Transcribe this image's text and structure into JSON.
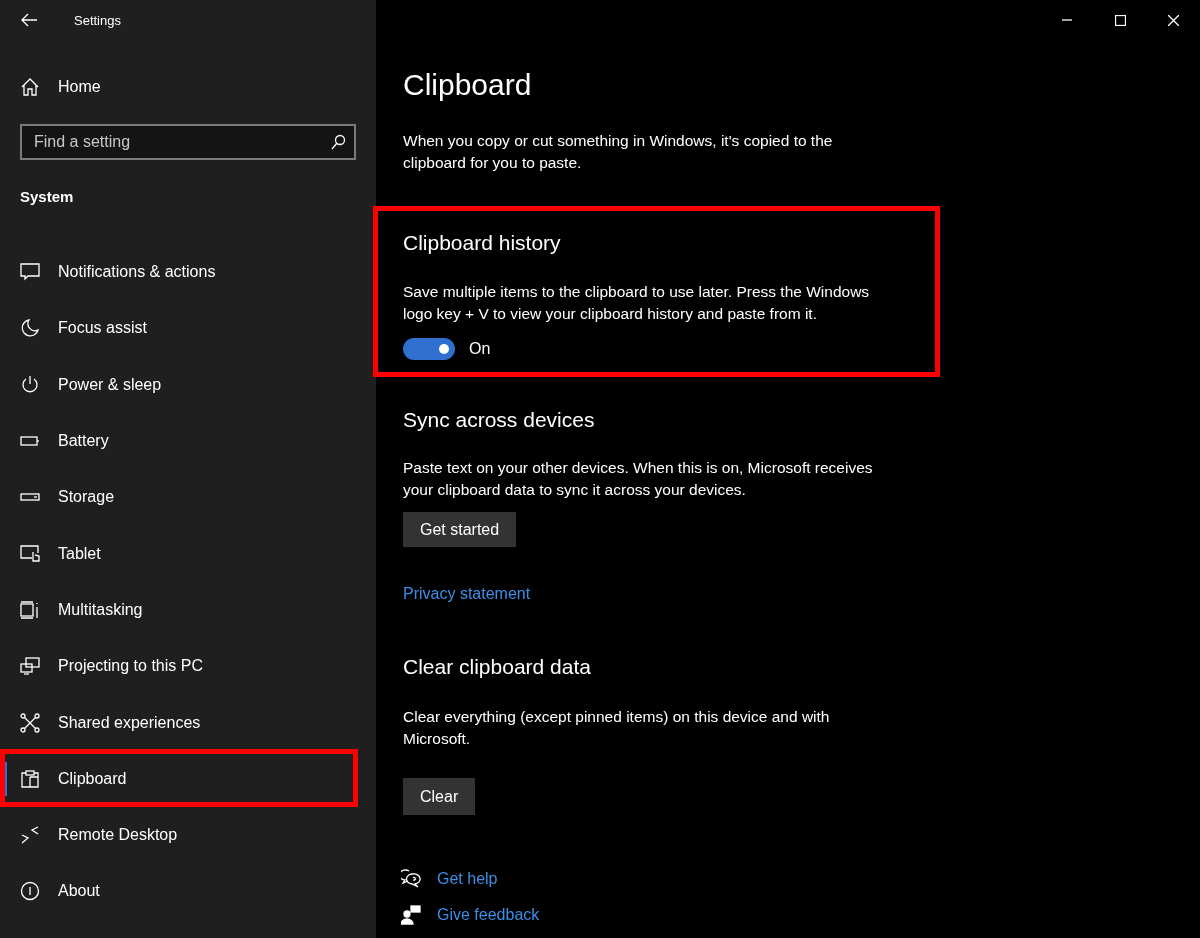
{
  "window": {
    "title": "Settings"
  },
  "sidebar": {
    "home": "Home",
    "search": {
      "placeholder": "Find a setting"
    },
    "group": "System",
    "items": [
      {
        "label": "Notifications & actions",
        "selected": false,
        "highlighted": false
      },
      {
        "label": "Focus assist",
        "selected": false,
        "highlighted": false
      },
      {
        "label": "Power & sleep",
        "selected": false,
        "highlighted": false
      },
      {
        "label": "Battery",
        "selected": false,
        "highlighted": false
      },
      {
        "label": "Storage",
        "selected": false,
        "highlighted": false
      },
      {
        "label": "Tablet",
        "selected": false,
        "highlighted": false
      },
      {
        "label": "Multitasking",
        "selected": false,
        "highlighted": false
      },
      {
        "label": "Projecting to this PC",
        "selected": false,
        "highlighted": false
      },
      {
        "label": "Shared experiences",
        "selected": false,
        "highlighted": false
      },
      {
        "label": "Clipboard",
        "selected": true,
        "highlighted": true
      },
      {
        "label": "Remote Desktop",
        "selected": false,
        "highlighted": false
      },
      {
        "label": "About",
        "selected": false,
        "highlighted": false
      }
    ]
  },
  "page": {
    "title": "Clipboard",
    "intro": "When you copy or cut something in Windows, it's copied to the clipboard for you to paste.",
    "sections": [
      {
        "kind": "toggle",
        "heading": "Clipboard history",
        "text": "Save multiple items to the clipboard to use later. Press the Windows logo key + V to view your clipboard history and paste from it.",
        "highlighted": true,
        "toggle": {
          "on": true,
          "label": "On"
        }
      },
      {
        "kind": "button",
        "heading": "Sync across devices",
        "text": "Paste text on your other devices. When this is on, Microsoft receives your clipboard data to sync it across your devices.",
        "highlighted": false,
        "button": "Get started",
        "link": "Privacy statement"
      },
      {
        "kind": "button",
        "heading": "Clear clipboard data",
        "text": "Clear everything (except pinned items) on this device and with Microsoft.",
        "highlighted": false,
        "button": "Clear"
      }
    ],
    "help_links": [
      "Get help",
      "Give feedback"
    ]
  }
}
